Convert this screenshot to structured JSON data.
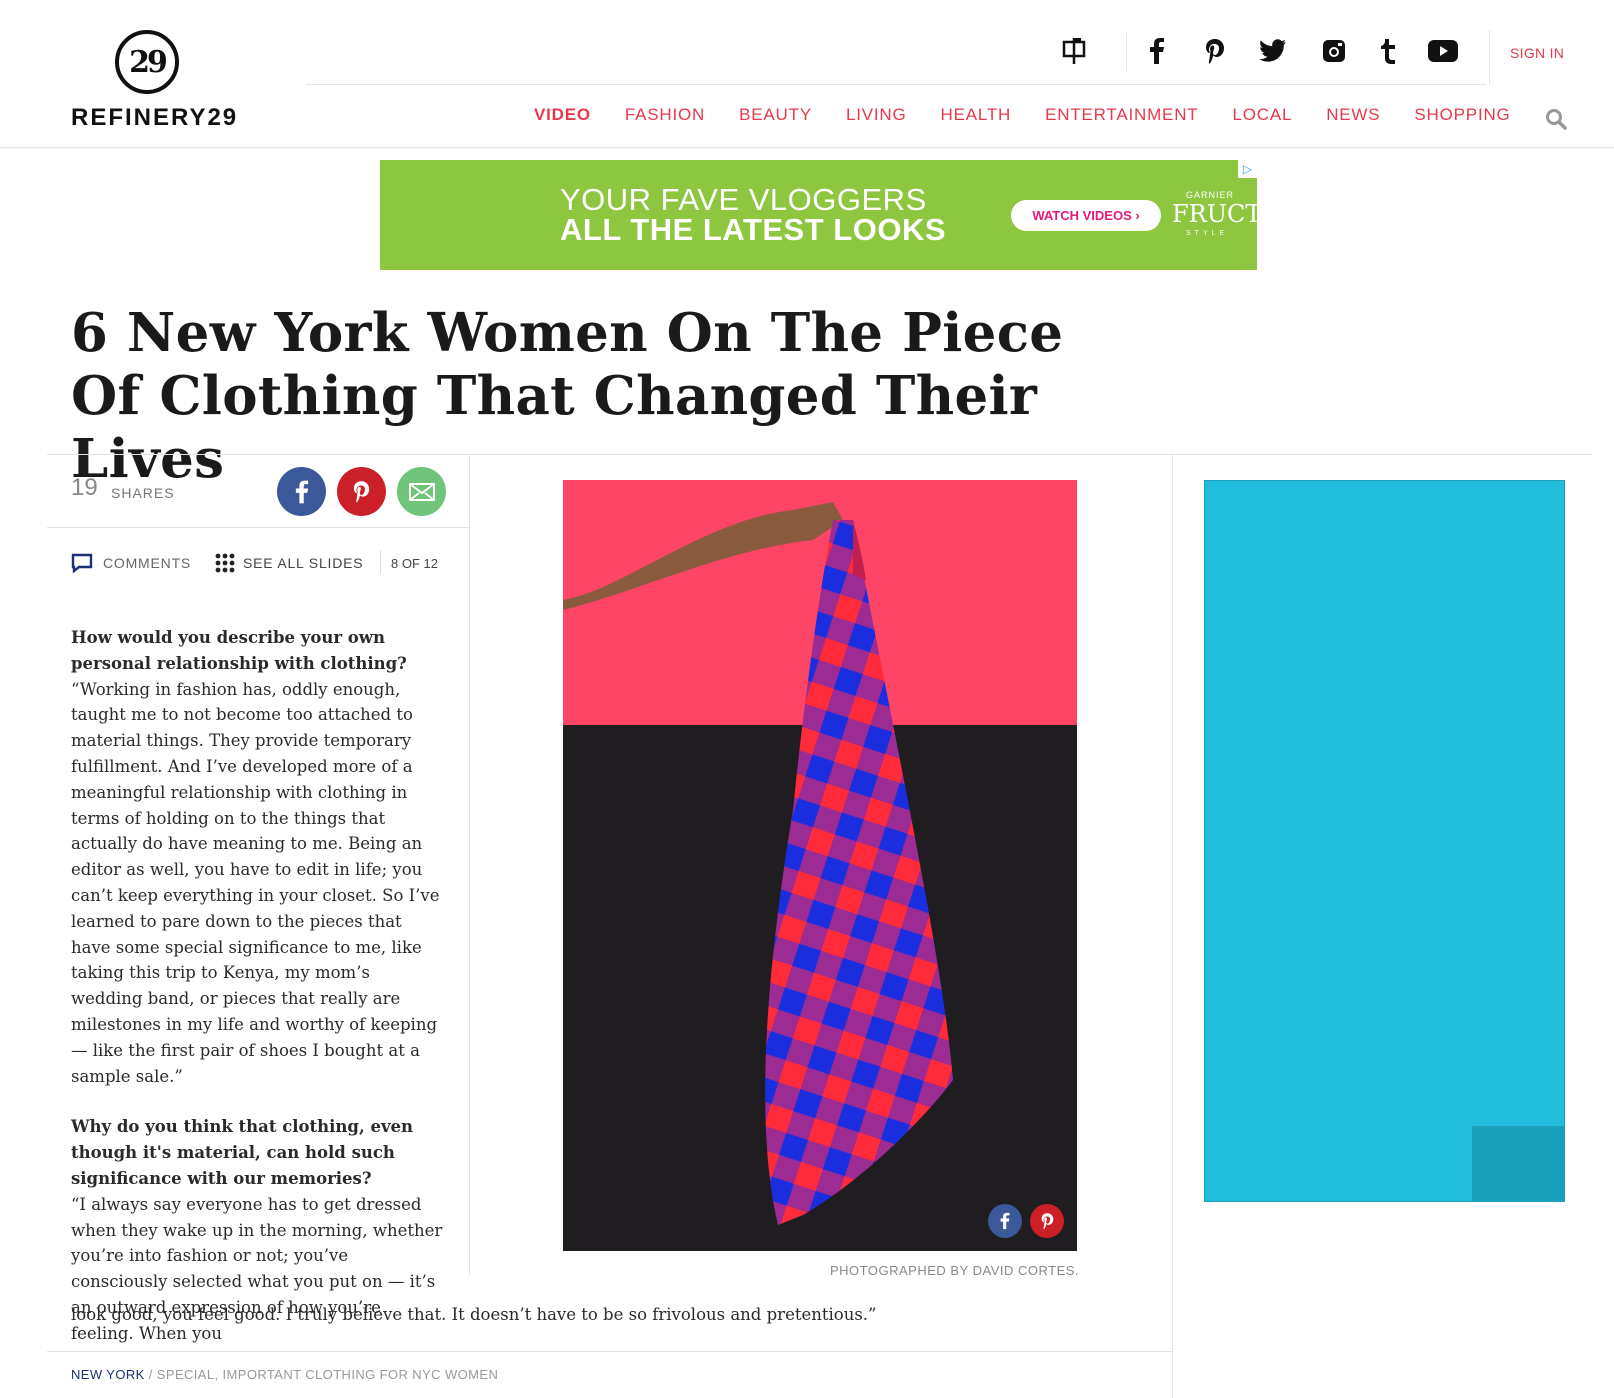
{
  "brand": {
    "logo_mark": "29",
    "logo_text": "REFINERY29",
    "accent_color": "#e8394b"
  },
  "header": {
    "social_icons": [
      "mailbox-icon",
      "facebook-icon",
      "pinterest-icon",
      "twitter-icon",
      "instagram-icon",
      "tumblr-icon",
      "youtube-icon"
    ],
    "sign_in": "SIGN IN",
    "nav": [
      {
        "label": "VIDEO",
        "active": true
      },
      {
        "label": "FASHION"
      },
      {
        "label": "BEAUTY"
      },
      {
        "label": "LIVING"
      },
      {
        "label": "HEALTH"
      },
      {
        "label": "ENTERTAINMENT"
      },
      {
        "label": "LOCAL"
      },
      {
        "label": "NEWS"
      },
      {
        "label": "SHOPPING"
      }
    ]
  },
  "ad_banner": {
    "line1": "YOUR FAVE VLOGGERS",
    "line2": "ALL THE LATEST LOOKS",
    "cta": "WATCH VIDEOS ›",
    "brand_top": "GARNIER",
    "brand": "FRUCTIS",
    "brand_bottom": "STYLE",
    "bg_color": "#8dc63f"
  },
  "article": {
    "headline": "6 New York Women On The Piece Of Clothing That Changed Their Lives",
    "share_count": "19",
    "shares_label": "SHARES",
    "comments_label": "COMMENTS",
    "see_all_label": "SEE ALL SLIDES",
    "slide_counter": "8 OF 12",
    "q1": "How would you describe your own personal relationship with clothing?",
    "a1": "“Working in fashion has, oddly enough, taught me to not become too attached to material things. They provide temporary fulfillment. And I’ve developed more of a meaningful relationship with clothing in terms of holding on to the things that actually do have meaning to me. Being an editor as well, you have to edit in life; you can’t keep everything in your closet. So I’ve learned to pare down to the pieces that have some special significance to me, like taking this trip to Kenya, my mom’s wedding band, or pieces that really are milestones in my life and worthy of keeping — like the first pair of shoes I bought at a sample sale.”",
    "q2": "Why do you think that clothing, even though it's material, can hold such significance with our memories?",
    "a2": "“I always say everyone has to get dressed when they wake up in the morning, whether you’re into fashion or not; you’ve consciously selected what you put on — it’s an outward expression of how you’re feeling. When you",
    "a2_tail": "look good, you feel good. I truly believe that. It doesn’t have to be so frivolous and pretentious.”",
    "photo_caption": "PHOTOGRAPHED BY DAVID CORTES."
  },
  "breadcrumb": {
    "city": "NEW YORK",
    "sep": " / ",
    "tag": "SPECIAL, IMPORTANT CLOTHING FOR NYC WOMEN"
  },
  "side_ad": {
    "bg_color": "#22bcdc"
  }
}
